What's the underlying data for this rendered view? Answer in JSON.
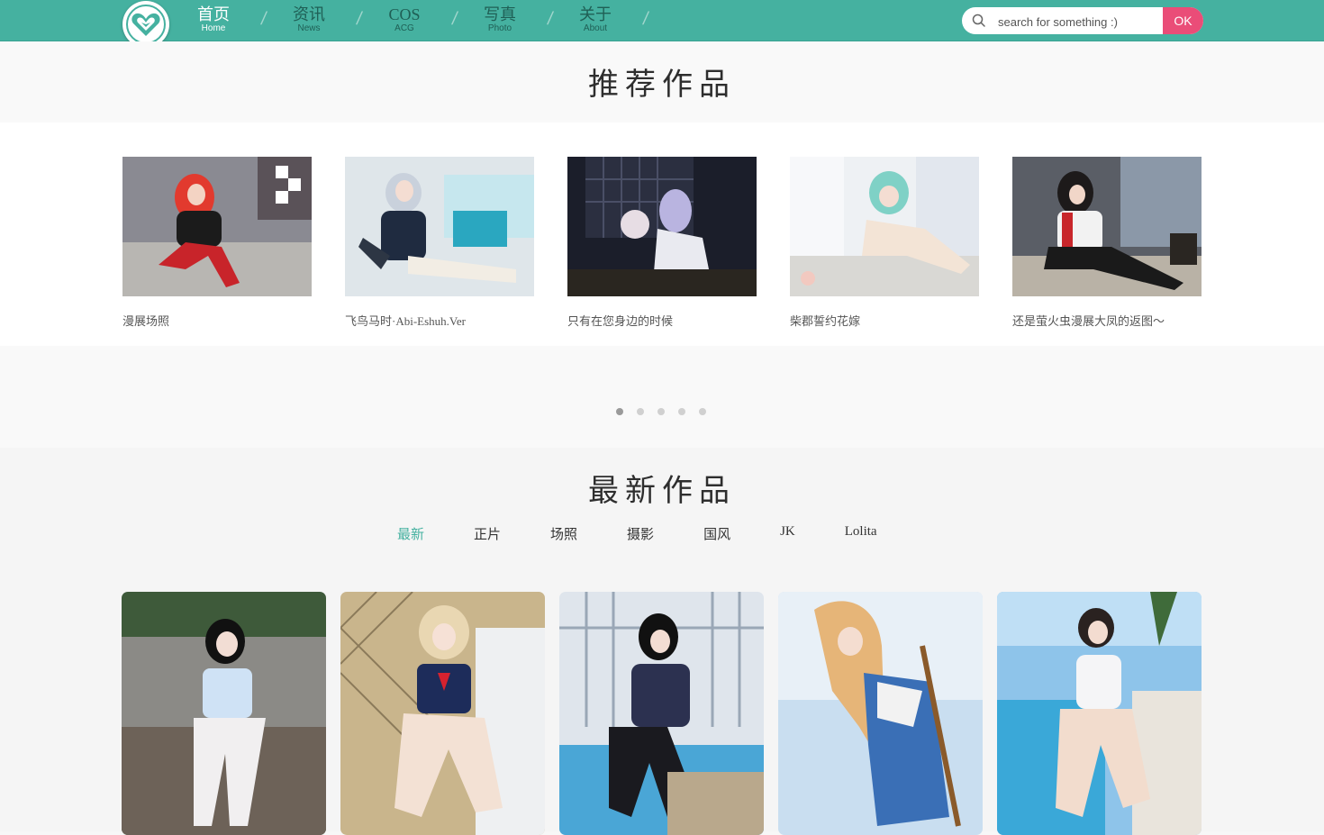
{
  "nav": {
    "items": [
      {
        "zh": "首页",
        "en": "Home"
      },
      {
        "zh": "资讯",
        "en": "News"
      },
      {
        "zh": "COS",
        "en": "ACG"
      },
      {
        "zh": "写真",
        "en": "Photo"
      },
      {
        "zh": "关于",
        "en": "About"
      }
    ],
    "active_index": 0,
    "separator": "/"
  },
  "search": {
    "placeholder": "search for something :)",
    "button_label": "OK"
  },
  "recommended": {
    "title": "推荐作品",
    "cards": [
      {
        "caption": "漫展场照"
      },
      {
        "caption": "飞鸟马时·Abi-Eshuh.Ver"
      },
      {
        "caption": "只有在您身边的时候"
      },
      {
        "caption": "柴郡誓约花嫁"
      },
      {
        "caption": "还是萤火虫漫展大凤的返图～"
      }
    ],
    "pagination": {
      "pages": 5,
      "active": 1
    }
  },
  "latest": {
    "title": "最新作品",
    "tabs": [
      "最新",
      "正片",
      "场照",
      "摄影",
      "国风",
      "JK",
      "Lolita"
    ],
    "active_tab": 0,
    "photo_count": 5
  },
  "colors": {
    "brand": "#45b1a0",
    "accent": "#ea4d78",
    "active_tab": "#45b1a0"
  }
}
